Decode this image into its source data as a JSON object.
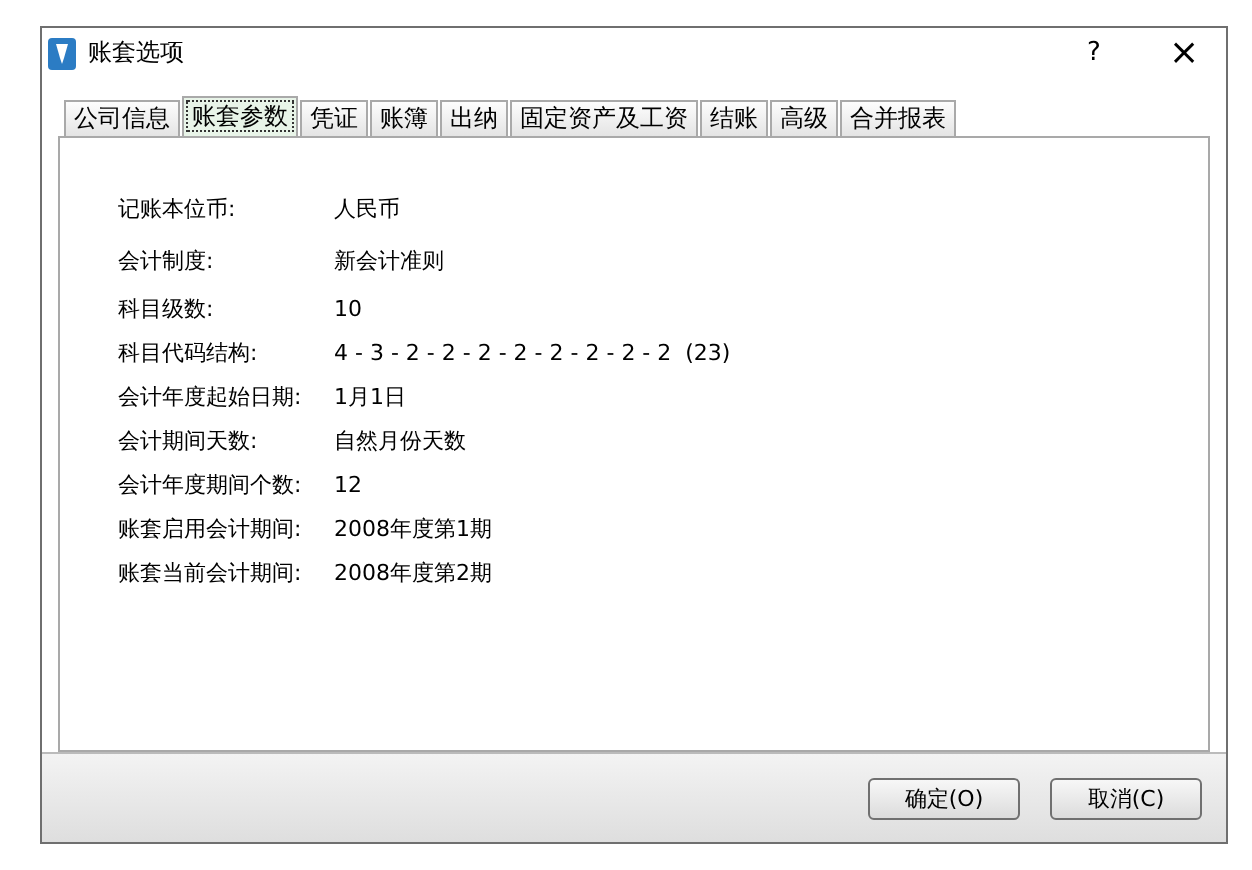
{
  "window": {
    "title": "账套选项",
    "help": "?",
    "close": "×"
  },
  "tabs": [
    {
      "label": "公司信息",
      "selected": false
    },
    {
      "label": "账套参数",
      "selected": true
    },
    {
      "label": "凭证",
      "selected": false
    },
    {
      "label": "账簿",
      "selected": false
    },
    {
      "label": "出纳",
      "selected": false
    },
    {
      "label": "固定资产及工资",
      "selected": false
    },
    {
      "label": "结账",
      "selected": false
    },
    {
      "label": "高级",
      "selected": false
    },
    {
      "label": "合并报表",
      "selected": false
    }
  ],
  "fields": [
    {
      "label": "记账本位币:",
      "value": "人民币"
    },
    {
      "label": "会计制度:",
      "value": "新会计准则"
    },
    {
      "label": "科目级数:",
      "value": "10"
    },
    {
      "label": "科目代码结构:",
      "value": "4 - 3 - 2 - 2 - 2 - 2 - 2 - 2 - 2 - 2  (23)"
    },
    {
      "label": "会计年度起始日期:",
      "value": "1月1日"
    },
    {
      "label": "会计期间天数:",
      "value": "自然月份天数"
    },
    {
      "label": "会计年度期间个数:",
      "value": "12"
    },
    {
      "label": "账套启用会计期间:",
      "value": "2008年度第1期"
    },
    {
      "label": "账套当前会计期间:",
      "value": "2008年度第2期"
    }
  ],
  "buttons": [
    "确定(O)",
    "取消(C)"
  ]
}
